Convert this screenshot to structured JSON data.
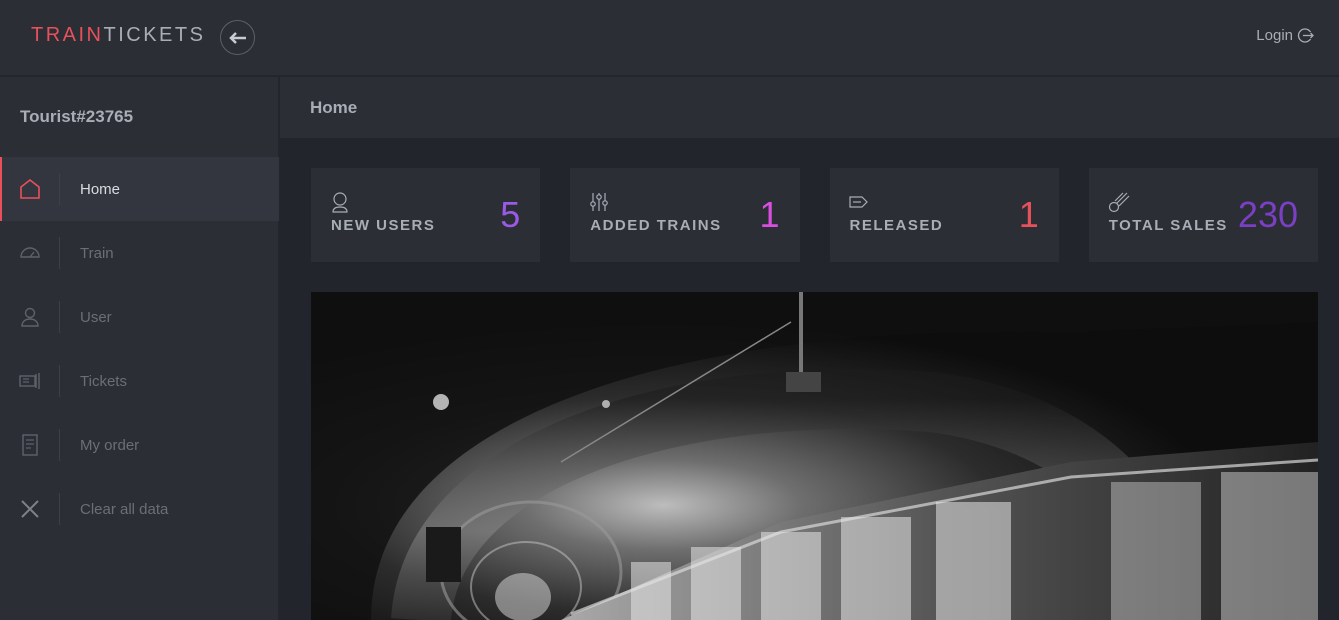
{
  "header": {
    "brand_part1": "TRAIN",
    "brand_part2": "TICKETS",
    "login_label": "Login"
  },
  "sidebar": {
    "user": "Tourist#23765",
    "items": [
      {
        "label": "Home",
        "icon": "home-icon",
        "active": true
      },
      {
        "label": "Train",
        "icon": "speedometer-icon"
      },
      {
        "label": "User",
        "icon": "user-icon"
      },
      {
        "label": "Tickets",
        "icon": "ticket-icon"
      },
      {
        "label": "My order",
        "icon": "receipt-icon"
      },
      {
        "label": "Clear all data",
        "icon": "close-icon"
      }
    ]
  },
  "breadcrumb": "Home",
  "stats": [
    {
      "label": "NEW USERS",
      "value": "5",
      "color": "#9b59e8",
      "icon": "user-icon"
    },
    {
      "label": "ADDED TRAINS",
      "value": "1",
      "color": "#d94fe0",
      "icon": "sliders-icon"
    },
    {
      "label": "RELEASED",
      "value": "1",
      "color": "#e8505b",
      "icon": "tag-icon"
    },
    {
      "label": "TOTAL SALES",
      "value": "230",
      "color": "#7b3fc4",
      "icon": "meteor-icon"
    }
  ],
  "colors": {
    "accent": "#e8505b",
    "background": "#22252c",
    "panel": "#2b2e35"
  }
}
